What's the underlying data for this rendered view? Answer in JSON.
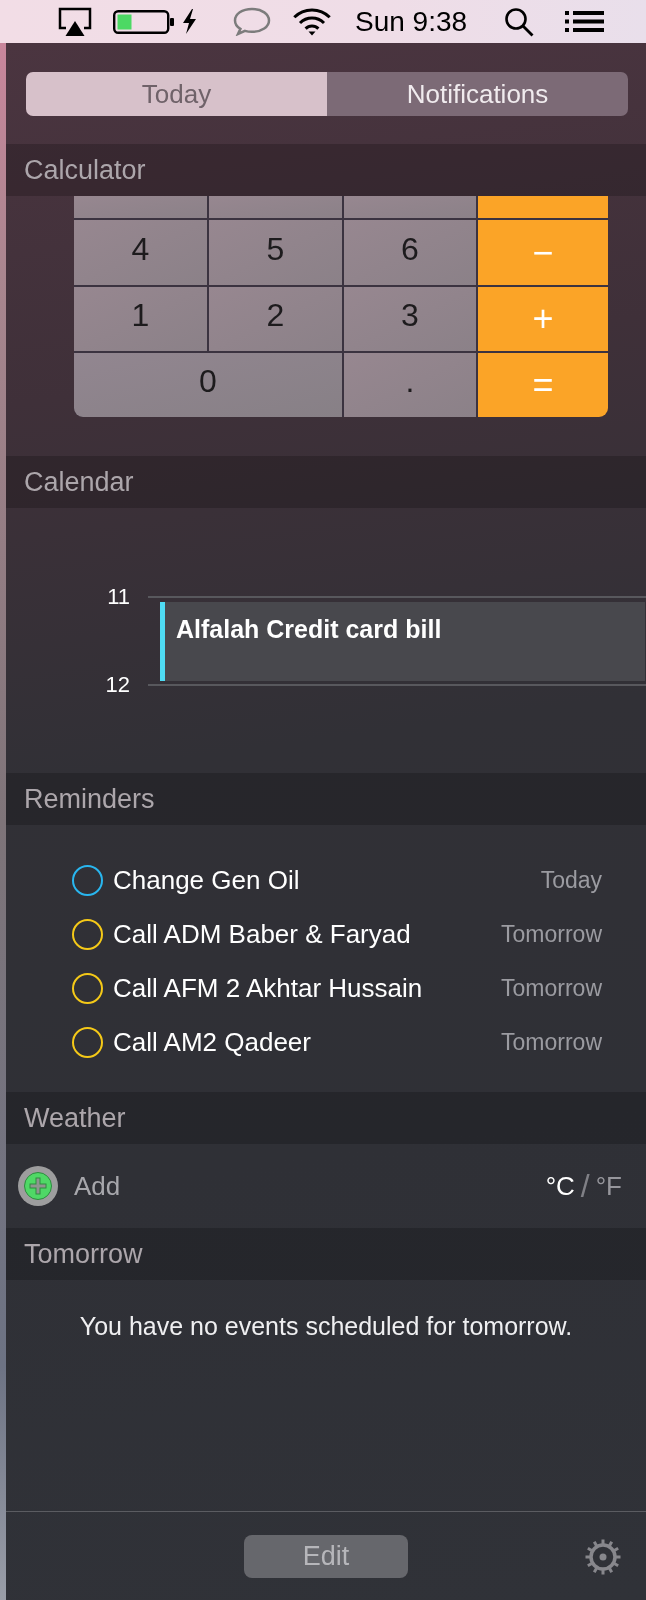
{
  "menu_bar": {
    "clock": "Sun 9:38"
  },
  "tabs": [
    {
      "label": "Today",
      "selected": true
    },
    {
      "label": "Notifications",
      "selected": false
    }
  ],
  "calculator": {
    "title": "Calculator",
    "clipped_keys": [
      {
        "kind": "digit"
      },
      {
        "kind": "digit"
      },
      {
        "kind": "digit"
      },
      {
        "kind": "operator"
      }
    ],
    "keys": [
      {
        "label": "4",
        "kind": "digit"
      },
      {
        "label": "5",
        "kind": "digit"
      },
      {
        "label": "6",
        "kind": "digit"
      },
      {
        "label": "−",
        "kind": "operator"
      },
      {
        "label": "1",
        "kind": "digit"
      },
      {
        "label": "2",
        "kind": "digit"
      },
      {
        "label": "3",
        "kind": "digit"
      },
      {
        "label": "+",
        "kind": "operator"
      },
      {
        "label": "0",
        "kind": "wide-digit"
      },
      {
        "label": ".",
        "kind": "digit"
      },
      {
        "label": "=",
        "kind": "operator"
      }
    ]
  },
  "calendar": {
    "title": "Calendar",
    "hours": [
      "11",
      "12"
    ],
    "events": [
      {
        "title": "Alfalah Credit card bill",
        "color": "#4fdcf4"
      }
    ]
  },
  "reminders": {
    "title": "Reminders",
    "items": [
      {
        "title": "Change Gen Oil",
        "due": "Today",
        "color": "#29b6ef",
        "checked": false
      },
      {
        "title": "Call ADM Baber & Faryad",
        "due": "Tomorrow",
        "color": "#f5c918",
        "checked": false
      },
      {
        "title": "Call AFM 2 Akhtar Hussain",
        "due": "Tomorrow",
        "color": "#f5c918",
        "checked": false
      },
      {
        "title": "Call AM2 Qadeer",
        "due": "Tomorrow",
        "color": "#f5c918",
        "checked": false
      }
    ]
  },
  "weather": {
    "title": "Weather",
    "add_label": "Add",
    "units": [
      {
        "label": "°C",
        "selected": true
      },
      {
        "label": "°F",
        "selected": false
      }
    ],
    "separator": "/"
  },
  "tomorrow": {
    "title": "Tomorrow",
    "message": "You have no events scheduled for tomorrow."
  },
  "footer": {
    "edit_button": "Edit"
  }
}
